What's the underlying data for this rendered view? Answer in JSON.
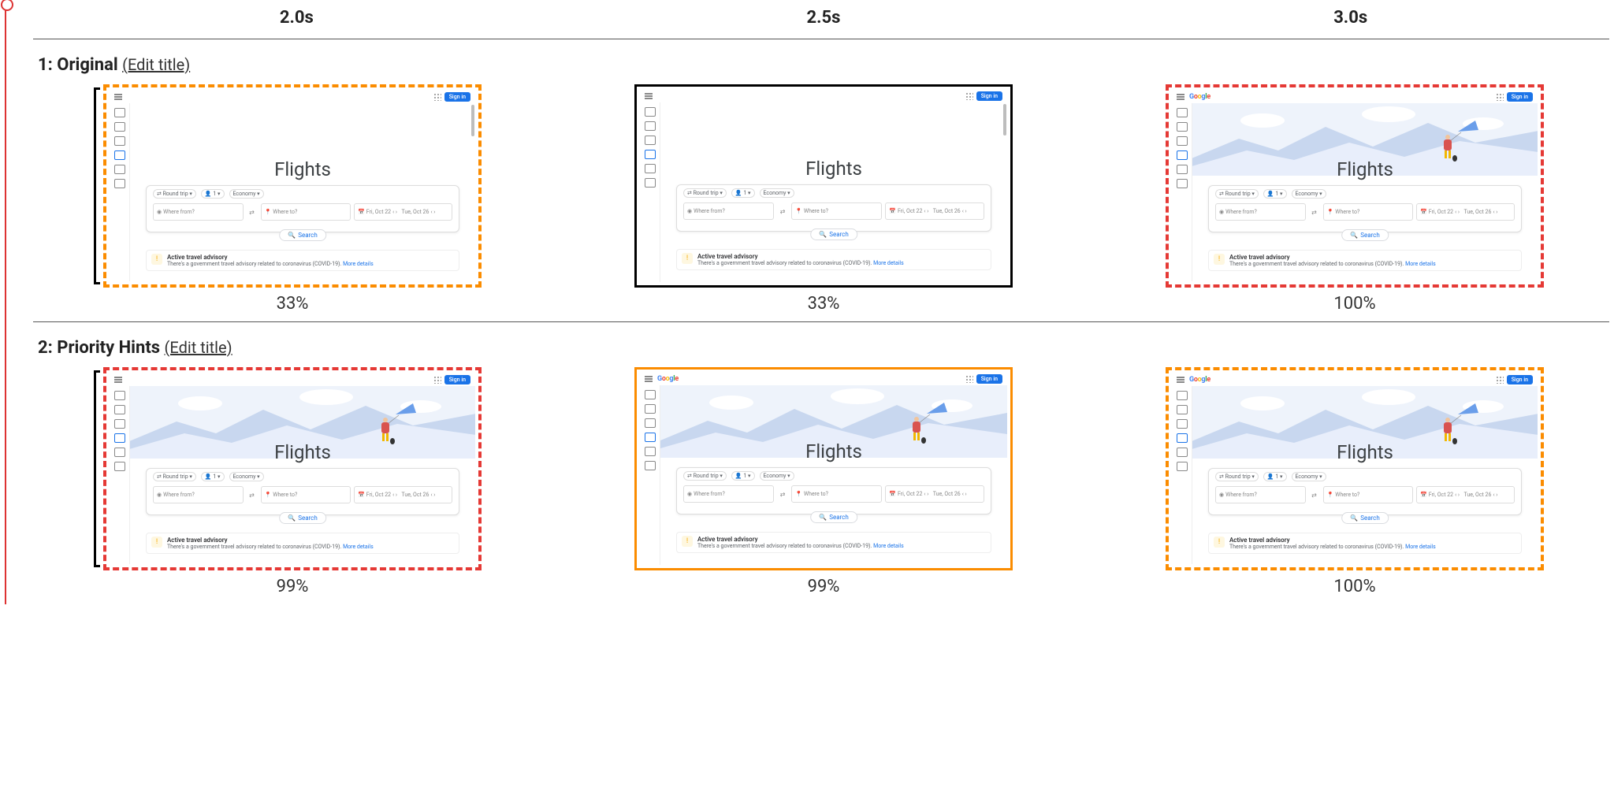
{
  "time_labels": [
    "2.0s",
    "2.5s",
    "3.0s"
  ],
  "rows": [
    {
      "index": "1",
      "title": "Original",
      "edit": "(Edit title)",
      "pct": [
        "33%",
        "33%",
        "100%"
      ]
    },
    {
      "index": "2",
      "title": "Priority Hints",
      "edit": "(Edit title)",
      "pct": [
        "99%",
        "99%",
        "100%"
      ]
    }
  ],
  "thumb": {
    "google_logo_letters": [
      "G",
      "o",
      "o",
      "g",
      "l",
      "e"
    ],
    "signin": "Sign in",
    "headline": "Flights",
    "trip_type": "Round trip",
    "passengers": "1",
    "cabin": "Economy",
    "from_placeholder": "Where from?",
    "to_placeholder": "Where to?",
    "date1": "Fri, Oct 22",
    "date2": "Tue, Oct 26",
    "search_btn": "Search",
    "advisory_title": "Active travel advisory",
    "advisory_desc_prefix": "There's a government travel advisory related to coronavirus (COVID-19). ",
    "advisory_more": "More details"
  }
}
